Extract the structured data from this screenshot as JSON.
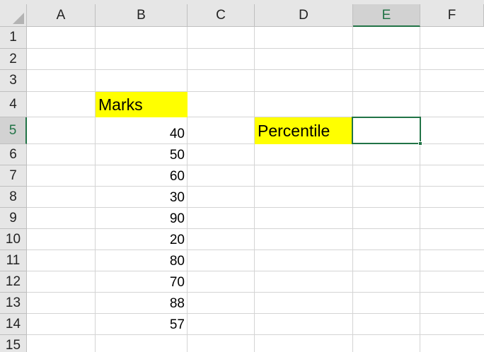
{
  "columns": [
    "A",
    "B",
    "C",
    "D",
    "E",
    "F"
  ],
  "rows": [
    "1",
    "2",
    "3",
    "4",
    "5",
    "6",
    "7",
    "8",
    "9",
    "10",
    "11",
    "12",
    "13",
    "14",
    "15"
  ],
  "active_cell": {
    "column": "E",
    "row": "5"
  },
  "cells": {
    "B4": "Marks",
    "D5": "Percentile",
    "B5": "40",
    "B6": "50",
    "B7": "60",
    "B8": "30",
    "B9": "90",
    "B10": "20",
    "B11": "80",
    "B12": "70",
    "B13": "88",
    "B14": "57"
  },
  "colors": {
    "highlight": "#ffff00",
    "selection": "#217346",
    "header_bg": "#e6e6e6"
  }
}
